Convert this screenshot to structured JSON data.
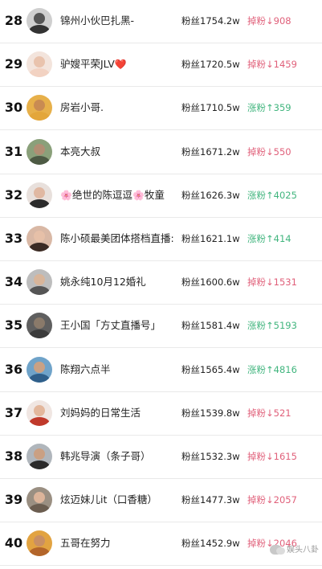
{
  "rows": [
    {
      "rank": "28",
      "name": "锦州小伙巴扎黑-",
      "flower_before": "",
      "flower_after": "",
      "name_tail": "",
      "fans": "粉丝1754.2w",
      "change": "掉粉↓908",
      "direction": "down",
      "avatar": {
        "bg": "#cfcfcf",
        "face": "#555",
        "body": "#333"
      }
    },
    {
      "rank": "29",
      "name": "驴嫂平荣JLV",
      "flower_before": "",
      "flower_after": "❤️",
      "name_tail": "",
      "fans": "粉丝1720.5w",
      "change": "掉粉↓1459",
      "direction": "down",
      "avatar": {
        "bg": "#f3e4dc",
        "face": "#e9c3ad",
        "body": "#f2d2c2"
      }
    },
    {
      "rank": "30",
      "name": "房岩小哥.",
      "flower_before": "",
      "flower_after": "",
      "name_tail": "",
      "fans": "粉丝1710.5w",
      "change": "涨粉↑359",
      "direction": "up",
      "avatar": {
        "bg": "#e7b04a",
        "face": "#c98b52",
        "body": "#e3a63a"
      }
    },
    {
      "rank": "31",
      "name": "本亮大叔",
      "flower_before": "",
      "flower_after": "",
      "name_tail": "",
      "fans": "粉丝1671.2w",
      "change": "掉粉↓550",
      "direction": "down",
      "avatar": {
        "bg": "#8aa07a",
        "face": "#b08e73",
        "body": "#4d5a44"
      }
    },
    {
      "rank": "32",
      "name": "绝世的陈逗逗",
      "flower_before": "🌸",
      "flower_after": "🌸",
      "name_tail": "牧童",
      "fans": "粉丝1626.3w",
      "change": "涨粉↑4025",
      "direction": "up",
      "avatar": {
        "bg": "#e8e0dc",
        "face": "#e0b8a2",
        "body": "#2b2b2b"
      }
    },
    {
      "rank": "33",
      "name": "陈小硕最美团体搭档直播:",
      "flower_before": "",
      "flower_after": "",
      "name_tail": "",
      "fans": "粉丝1621.1w",
      "change": "涨粉↑414",
      "direction": "up",
      "avatar": {
        "bg": "#d9b8a5",
        "face": "#e6c0a8",
        "body": "#3a2a24"
      }
    },
    {
      "rank": "34",
      "name": "姚永纯10月12婚礼",
      "flower_before": "",
      "flower_after": "",
      "name_tail": "",
      "fans": "粉丝1600.6w",
      "change": "掉粉↓1531",
      "direction": "down",
      "avatar": {
        "bg": "#bdbdbd",
        "face": "#d8b59a",
        "body": "#555"
      }
    },
    {
      "rank": "35",
      "name": "王小国「方丈直播号」",
      "flower_before": "",
      "flower_after": "",
      "name_tail": "",
      "fans": "粉丝1581.4w",
      "change": "涨粉↑5193",
      "direction": "up",
      "avatar": {
        "bg": "#5f5f5f",
        "face": "#8a7a6a",
        "body": "#3b3b3b"
      }
    },
    {
      "rank": "36",
      "name": "陈翔六点半",
      "flower_before": "",
      "flower_after": "",
      "name_tail": "",
      "fans": "粉丝1565.4w",
      "change": "涨粉↑4816",
      "direction": "up",
      "avatar": {
        "bg": "#6fa3c9",
        "face": "#c9a184",
        "body": "#2f5f8a"
      }
    },
    {
      "rank": "37",
      "name": "刘妈妈的日常生活",
      "flower_before": "",
      "flower_after": "",
      "name_tail": "",
      "fans": "粉丝1539.8w",
      "change": "掉粉↓521",
      "direction": "down",
      "avatar": {
        "bg": "#f0e6e2",
        "face": "#e3b79c",
        "body": "#c0392b"
      }
    },
    {
      "rank": "38",
      "name": "韩兆导演（条子哥）",
      "flower_before": "",
      "flower_after": "",
      "name_tail": "",
      "fans": "粉丝1532.3w",
      "change": "掉粉↓1615",
      "direction": "down",
      "avatar": {
        "bg": "#b0b6bc",
        "face": "#caa083",
        "body": "#2a2a2a"
      }
    },
    {
      "rank": "39",
      "name": "炫迈妹儿it（口香糖）",
      "flower_before": "",
      "flower_after": "",
      "name_tail": "",
      "fans": "粉丝1477.3w",
      "change": "掉粉↓2057",
      "direction": "down",
      "avatar": {
        "bg": "#9a8f82",
        "face": "#dcb49a",
        "body": "#6b5d50"
      }
    },
    {
      "rank": "40",
      "name": "五哥在努力",
      "flower_before": "",
      "flower_after": "",
      "name_tail": "",
      "fans": "粉丝1452.9w",
      "change": "掉粉↓2046",
      "direction": "down",
      "avatar": {
        "bg": "#e2a341",
        "face": "#c98f64",
        "body": "#b3652a"
      }
    }
  ],
  "watermark": {
    "text": "娱头八卦",
    "icon": "wechat-icon"
  },
  "colors": {
    "down": "#e0607a",
    "up": "#41b57e"
  }
}
